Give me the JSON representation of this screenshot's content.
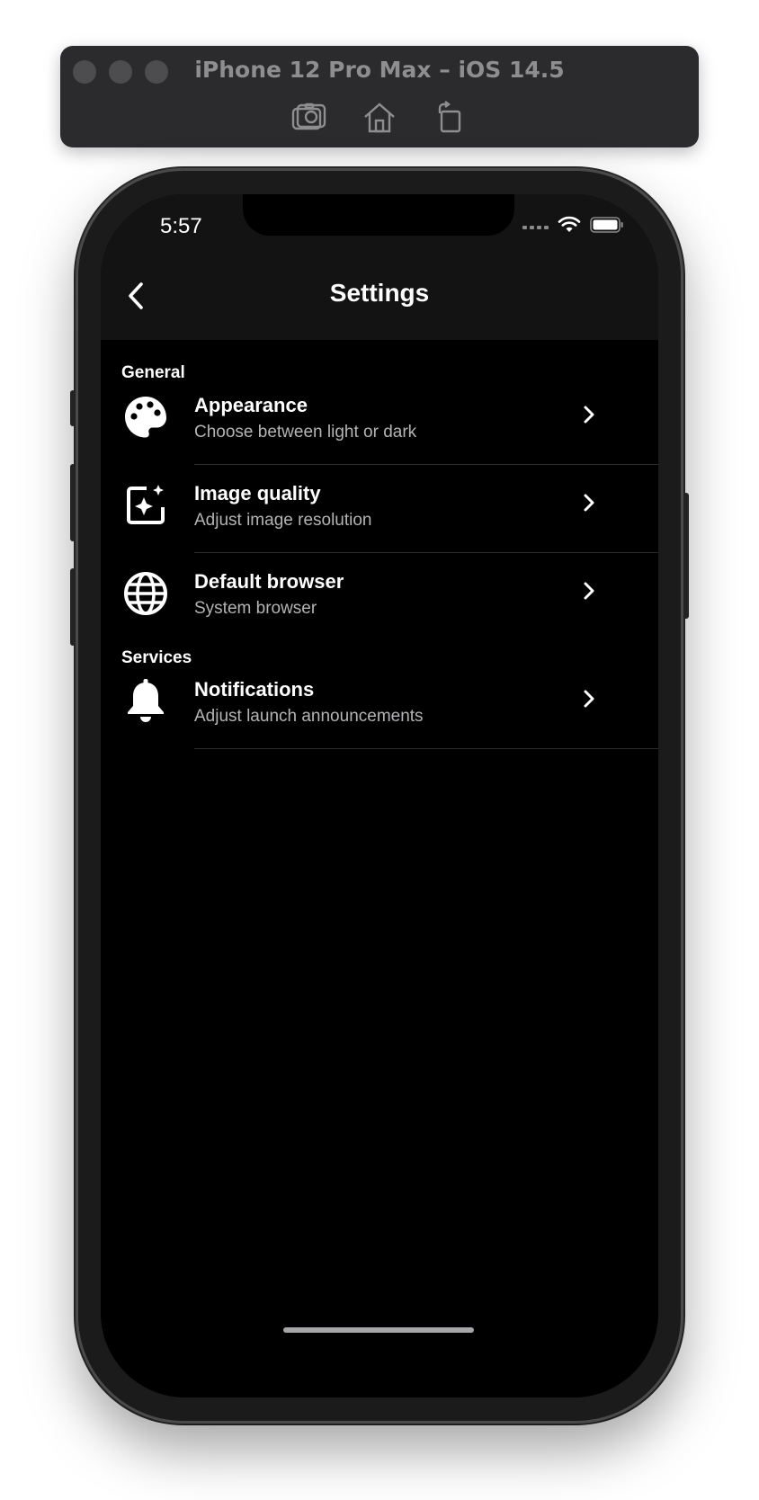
{
  "simulator": {
    "title": "iPhone 12 Pro Max – iOS 14.5",
    "tools": [
      "screenshot-icon",
      "home-icon",
      "rotate-icon"
    ]
  },
  "status_bar": {
    "time": "5:57"
  },
  "nav": {
    "title": "Settings"
  },
  "sections": [
    {
      "label": "General",
      "items": [
        {
          "title": "Appearance",
          "subtitle": "Choose between light or dark",
          "icon": "palette-icon"
        },
        {
          "title": "Image quality",
          "subtitle": "Adjust image resolution",
          "icon": "image-sparkle-icon"
        },
        {
          "title": "Default browser",
          "subtitle": "System browser",
          "icon": "globe-icon"
        }
      ]
    },
    {
      "label": "Services",
      "items": [
        {
          "title": "Notifications",
          "subtitle": "Adjust launch announcements",
          "icon": "bell-icon"
        }
      ]
    }
  ],
  "colors": {
    "background": "#000000",
    "nav_background": "#131314",
    "text": "#ffffff",
    "subtext": "#b4b4b6",
    "divider": "#2c2c2e"
  }
}
